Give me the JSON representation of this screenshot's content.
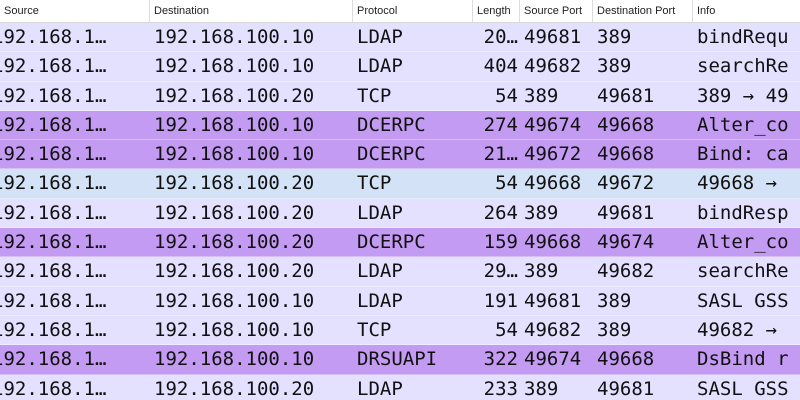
{
  "colors": {
    "ldap": "#e4e0ff",
    "tcp_selected": "#d3e2f7",
    "dcerpc": "#c49bf2",
    "drsuapi": "#c49bf2"
  },
  "columns": [
    "Source",
    "Destination",
    "Protocol",
    "Length",
    "Source Port",
    "Destination Port",
    "Info"
  ],
  "rows": [
    {
      "src": "192.168.1…",
      "dst": "192.168.100.10",
      "proto": "LDAP",
      "len": "20…",
      "sport": "49681",
      "dport": "389",
      "info": "bindRequ",
      "color": "#e4e0ff"
    },
    {
      "src": "192.168.1…",
      "dst": "192.168.100.10",
      "proto": "LDAP",
      "len": "404",
      "sport": "49682",
      "dport": "389",
      "info": "searchRe",
      "color": "#e4e0ff"
    },
    {
      "src": "192.168.1…",
      "dst": "192.168.100.20",
      "proto": "TCP",
      "len": "54",
      "sport": "389",
      "dport": "49681",
      "info": "389 → 49",
      "color": "#e4e0ff"
    },
    {
      "src": "192.168.1…",
      "dst": "192.168.100.10",
      "proto": "DCERPC",
      "len": "274",
      "sport": "49674",
      "dport": "49668",
      "info": "Alter_co",
      "color": "#c49bf2"
    },
    {
      "src": "192.168.1…",
      "dst": "192.168.100.10",
      "proto": "DCERPC",
      "len": "21…",
      "sport": "49672",
      "dport": "49668",
      "info": "Bind: ca",
      "color": "#c49bf2"
    },
    {
      "src": "192.168.1…",
      "dst": "192.168.100.20",
      "proto": "TCP",
      "len": "54",
      "sport": "49668",
      "dport": "49672",
      "info": "49668 →",
      "color": "#d3e2f7"
    },
    {
      "src": "192.168.1…",
      "dst": "192.168.100.20",
      "proto": "LDAP",
      "len": "264",
      "sport": "389",
      "dport": "49681",
      "info": "bindResp",
      "color": "#e4e0ff"
    },
    {
      "src": "192.168.1…",
      "dst": "192.168.100.20",
      "proto": "DCERPC",
      "len": "159",
      "sport": "49668",
      "dport": "49674",
      "info": "Alter_co",
      "color": "#c49bf2"
    },
    {
      "src": "192.168.1…",
      "dst": "192.168.100.20",
      "proto": "LDAP",
      "len": "29…",
      "sport": "389",
      "dport": "49682",
      "info": "searchRe",
      "color": "#e4e0ff"
    },
    {
      "src": "192.168.1…",
      "dst": "192.168.100.10",
      "proto": "LDAP",
      "len": "191",
      "sport": "49681",
      "dport": "389",
      "info": "SASL GSS",
      "color": "#e4e0ff"
    },
    {
      "src": "192.168.1…",
      "dst": "192.168.100.10",
      "proto": "TCP",
      "len": "54",
      "sport": "49682",
      "dport": "389",
      "info": "49682 →",
      "color": "#e4e0ff"
    },
    {
      "src": "192.168.1…",
      "dst": "192.168.100.10",
      "proto": "DRSUAPI",
      "len": "322",
      "sport": "49674",
      "dport": "49668",
      "info": "DsBind r",
      "color": "#c49bf2"
    },
    {
      "src": "192.168.1…",
      "dst": "192.168.100.20",
      "proto": "LDAP",
      "len": "233",
      "sport": "389",
      "dport": "49681",
      "info": "SASL GSS",
      "color": "#e4e0ff"
    }
  ]
}
